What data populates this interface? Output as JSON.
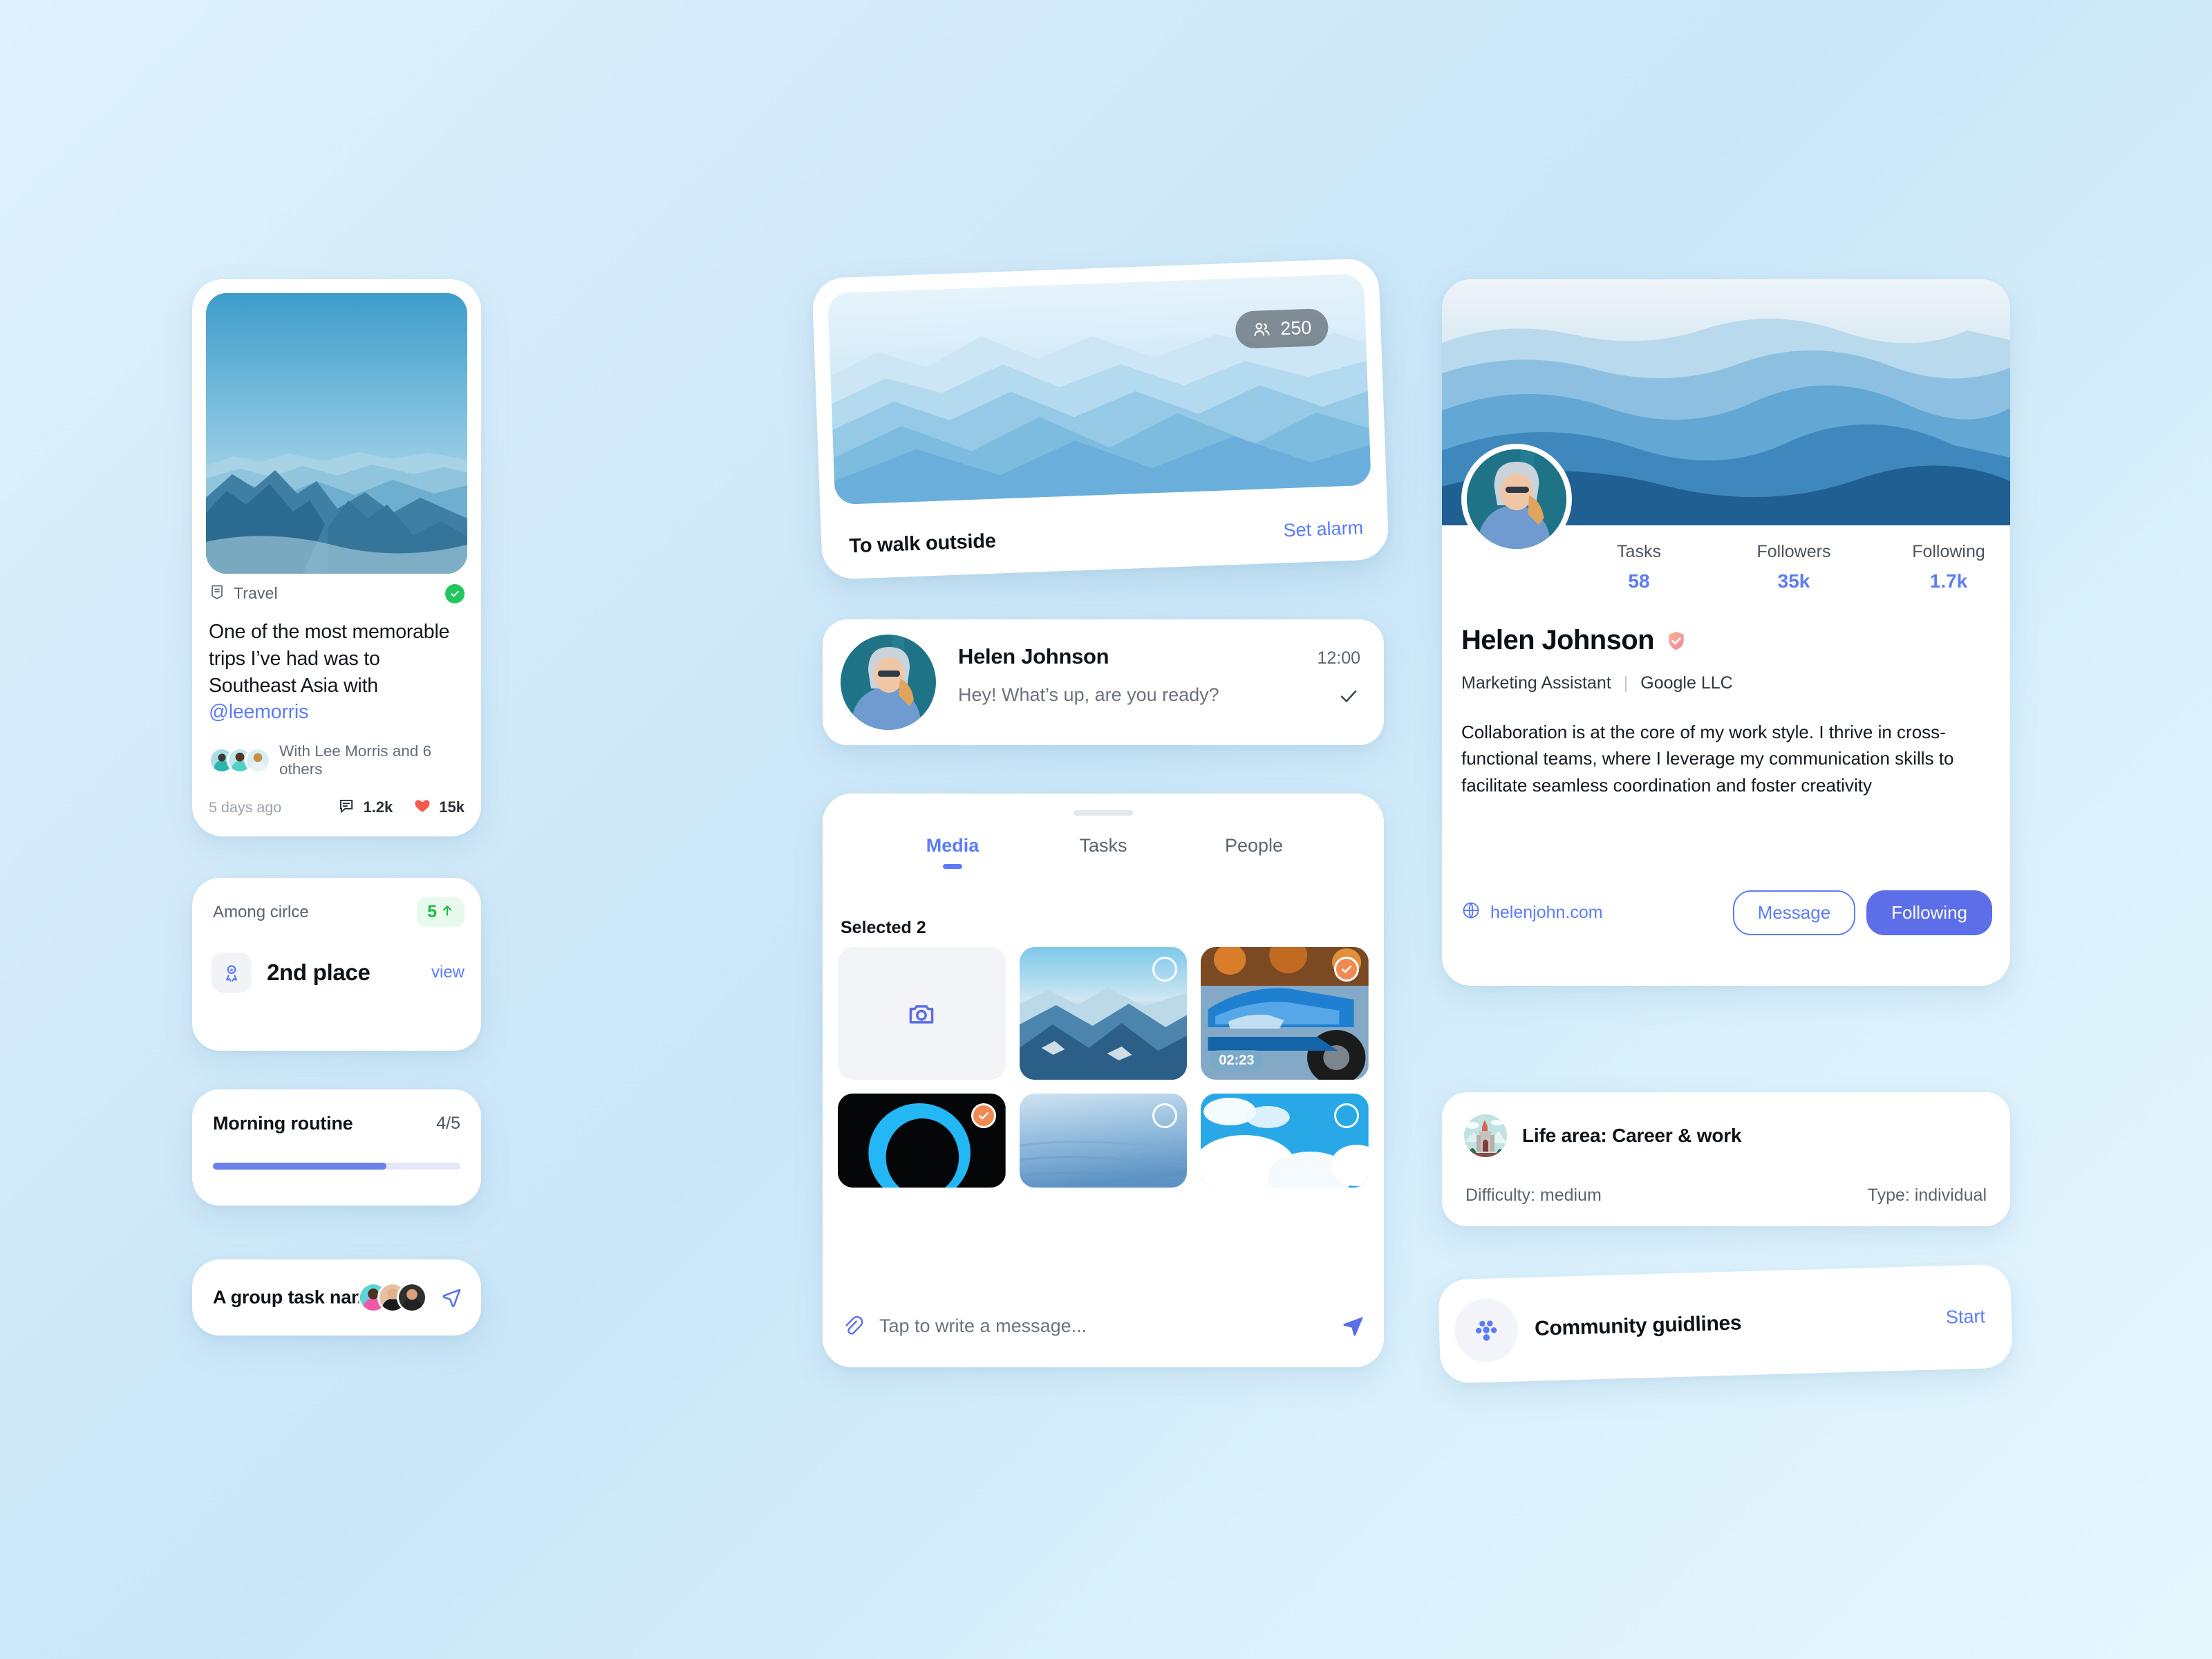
{
  "theme": {
    "accent_blue": "#5c7cf6",
    "solid_blue": "#5c6ee8",
    "success_green": "#22c55e",
    "up_green": "#1fbd45",
    "select_orange": "#f08a52",
    "bg_from": "#dff1fc",
    "bg_to": "#e6f6fd"
  },
  "post": {
    "category": "Travel",
    "verified_icon": "check-badge-icon",
    "category_icon": "bookmark-icon",
    "text_before": "One of the most memorable trips I’ve had was to Southeast Asia with ",
    "mention": "@leemorris",
    "with_text": "With Lee Morris and 6 others",
    "timestamp": "5 days ago",
    "comments": "1.2k",
    "likes": "15k",
    "comment_icon": "comment-icon",
    "like_icon": "heart-icon",
    "hero_alt": "mountain-range-photo"
  },
  "rank": {
    "title": "Among cirlce",
    "delta": "5",
    "delta_icon": "arrow-up-icon",
    "place": "2nd place",
    "place_icon": "medal-icon",
    "view_label": "view"
  },
  "routine": {
    "title": "Morning routine",
    "count": "4/5",
    "progress_percent": 70
  },
  "group_task": {
    "title": "A group task name",
    "send_icon": "send-outline-icon",
    "member_count": 3
  },
  "alarm": {
    "title": "To walk outside",
    "action": "Set alarm",
    "people_count": "250",
    "people_icon": "people-icon",
    "hero_alt": "misty-mountains-photo"
  },
  "message": {
    "name": "Helen Johnson",
    "time": "12:00",
    "preview": "Hey! What’s up, are you ready?",
    "status_icon": "check-icon",
    "avatar_alt": "helen-johnson-avatar"
  },
  "media": {
    "tabs": [
      {
        "label": "Media",
        "active": true
      },
      {
        "label": "Tasks",
        "active": false
      },
      {
        "label": "People",
        "active": false
      }
    ],
    "selected_label": "Selected 2",
    "items": [
      {
        "kind": "camera",
        "label": "camera-tile",
        "selected": false,
        "duration": ""
      },
      {
        "kind": "photo",
        "label": "snowy-peaks-photo",
        "selected": false,
        "duration": ""
      },
      {
        "kind": "video",
        "label": "blue-car-photo",
        "selected": true,
        "duration": "02:23"
      },
      {
        "kind": "photo",
        "label": "dark-portrait-photo",
        "selected": true,
        "duration": ""
      },
      {
        "kind": "photo",
        "label": "ice-field-photo",
        "selected": false,
        "duration": ""
      },
      {
        "kind": "photo",
        "label": "clouds-sky-photo",
        "selected": false,
        "duration": ""
      }
    ],
    "composer_placeholder": "Tap to write a message...",
    "attach_icon": "paperclip-icon",
    "send_icon": "send-filled-icon"
  },
  "profile": {
    "name": "Helen Johnson",
    "verified_icon": "shield-check-icon",
    "role": "Marketing Assistant",
    "company": "Google LLC",
    "bio": "Collaboration is at the core of my work style. I thrive in cross-functional teams, where I leverage my communication skills to facilitate seamless coordination and foster creativity",
    "website": "helenjohn.com",
    "website_icon": "globe-icon",
    "message_button": "Message",
    "follow_button": "Following",
    "stats": [
      {
        "key": "Tasks",
        "value": "58"
      },
      {
        "key": "Followers",
        "value": "35k"
      },
      {
        "key": "Following",
        "value": "1.7k"
      }
    ],
    "cover_alt": "blue-mountain-layers-cover",
    "avatar_alt": "helen-johnson-profile-photo"
  },
  "life_area": {
    "title": "Life area: Career & work",
    "icon": "castle-icon",
    "difficulty": "Difficulty: medium",
    "type": "Type: individual"
  },
  "guidelines": {
    "title": "Community guidlines",
    "action": "Start",
    "icon": "community-dots-icon"
  }
}
